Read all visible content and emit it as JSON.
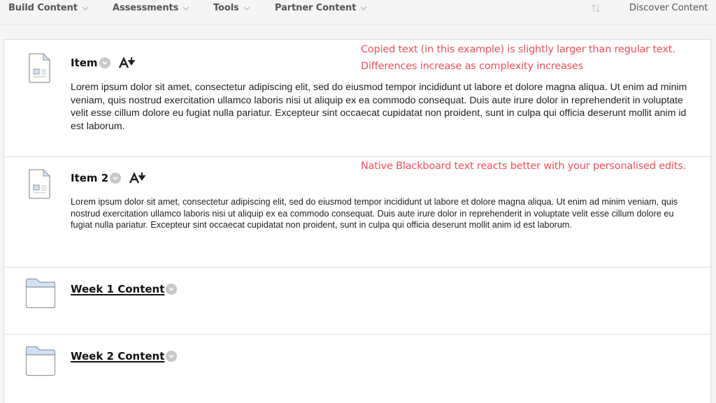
{
  "topbar": {
    "menus": [
      {
        "label": "Build Content"
      },
      {
        "label": "Assessments"
      },
      {
        "label": "Tools"
      },
      {
        "label": "Partner Content"
      }
    ],
    "discover_label": "Discover Content"
  },
  "items": [
    {
      "type": "item",
      "title": "Item",
      "body": "Lorem ipsum dolor sit amet, consectetur adipiscing elit, sed do eiusmod tempor incididunt ut labore et dolore magna aliqua. Ut enim ad minim veniam, quis nostrud exercitation ullamco laboris nisi ut aliquip ex ea commodo consequat. Duis aute irure dolor in reprehenderit in voluptate velit esse cillum dolore eu fugiat nulla pariatur. Excepteur sint occaecat cupidatat non proident, sunt in culpa qui officia deserunt mollit anim id est laborum.",
      "note": "Copied text (in this example) is slightly larger than regular text. Differences increase as complexity increases"
    },
    {
      "type": "item",
      "title": "Item 2",
      "body": "Lorem ipsum dolor sit amet, consectetur adipiscing elit, sed do eiusmod tempor incididunt ut labore et dolore magna aliqua. Ut enim ad minim veniam, quis nostrud exercitation ullamco laboris nisi ut aliquip ex ea commodo consequat. Duis aute irure dolor in reprehenderit in voluptate velit esse cillum dolore eu fugiat nulla pariatur. Excepteur sint occaecat cupidatat non proident, sunt in culpa qui officia deserunt mollit anim id est laborum.",
      "note": "Native Blackboard text reacts better with your personalised edits."
    },
    {
      "type": "folder",
      "title": "Week 1 Content"
    },
    {
      "type": "folder",
      "title": "Week 2 Content"
    }
  ],
  "colors": {
    "annotation": "#f0505a",
    "folder_tab": "#cfe2fa"
  }
}
